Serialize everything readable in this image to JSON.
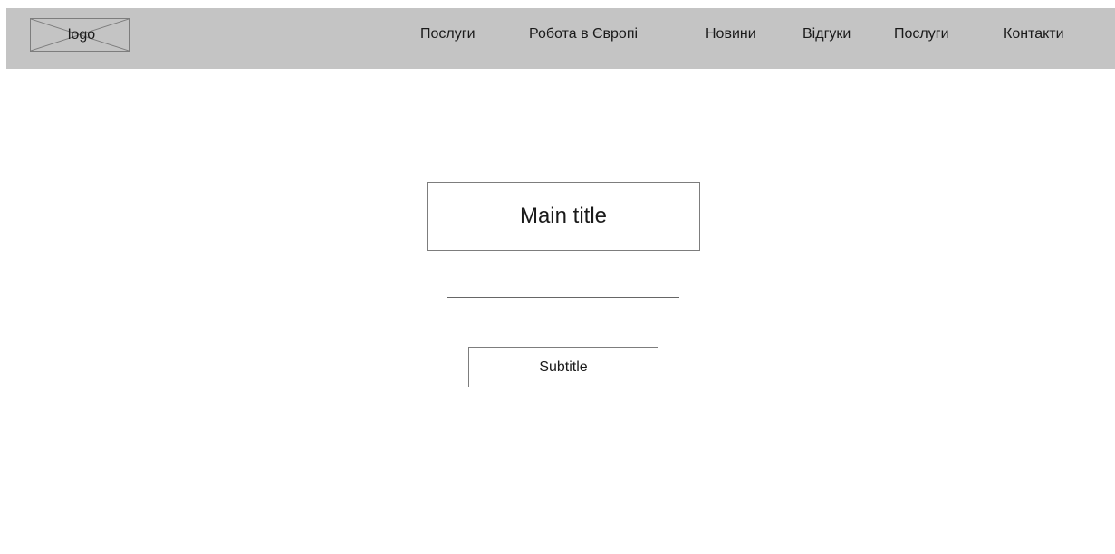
{
  "header": {
    "logo_text": "logo",
    "nav": [
      {
        "label": "Послуги"
      },
      {
        "label": "Робота в Європі"
      },
      {
        "label": "Новини"
      },
      {
        "label": "Відгуки"
      },
      {
        "label": "Послуги"
      },
      {
        "label": "Контакти"
      }
    ]
  },
  "hero": {
    "title": "Main title",
    "subtitle": "Subtitle"
  },
  "colors": {
    "header_background": "#c4c4c4",
    "page_background": "#ffffff",
    "box_border": "#7d7d7d",
    "text": "#1a1a1a"
  }
}
